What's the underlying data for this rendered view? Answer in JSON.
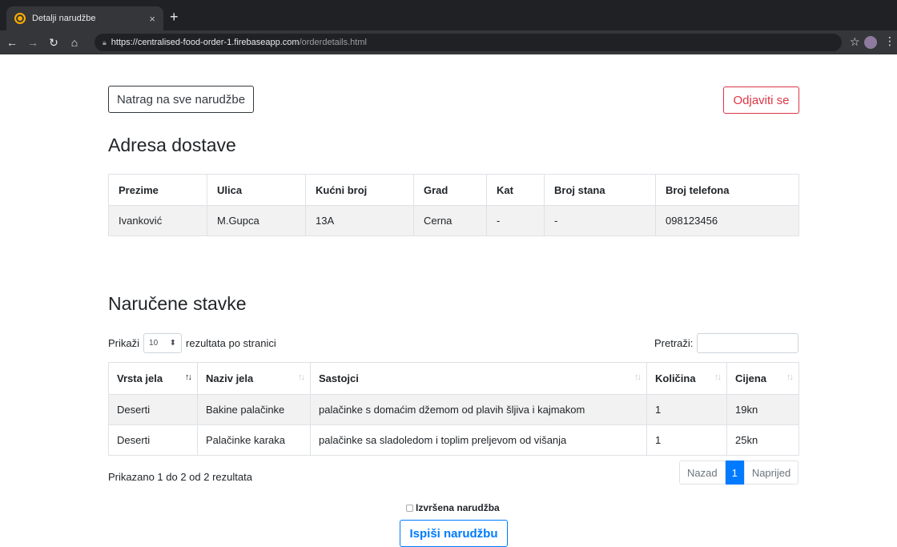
{
  "browser": {
    "tab_title": "Detalji narudžbe",
    "tab_close": "×",
    "new_tab": "+",
    "url_host": "https://centralised-food-order-1.firebaseapp.com",
    "url_path": "/orderdetails.html",
    "icons": [
      "back-icon",
      "forward-icon",
      "reload-icon",
      "home-icon",
      "lock-icon",
      "star-icon",
      "menu-icon"
    ]
  },
  "header": {
    "back_button": "Natrag na sve narudžbe",
    "logout_button": "Odjaviti se"
  },
  "address": {
    "title": "Adresa dostave",
    "columns": [
      "Prezime",
      "Ulica",
      "Kućni broj",
      "Grad",
      "Kat",
      "Broj stana",
      "Broj telefona"
    ],
    "row": [
      "Ivanković",
      "M.Gupca",
      "13A",
      "Cerna",
      "-",
      "-",
      "098123456"
    ]
  },
  "items": {
    "title": "Naručene stavke",
    "length_prefix": "Prikaži",
    "length_value": "10",
    "length_suffix": "rezultata po stranici",
    "search_label": "Pretraži:",
    "columns": [
      "Vrsta jela",
      "Naziv jela",
      "Sastojci",
      "Količina",
      "Cijena"
    ],
    "rows": [
      [
        "Deserti",
        "Bakine palačinke",
        "palačinke s domaćim džemom od plavih šljiva i kajmakom",
        "1",
        "19kn"
      ],
      [
        "Deserti",
        "Palačinke karaka",
        "palačinke sa sladoledom i toplim preljevom od višanja",
        "1",
        "25kn"
      ]
    ],
    "info": "Prikazano 1 do 2 od 2 rezultata",
    "pager": {
      "prev": "Nazad",
      "current": "1",
      "next": "Naprijed"
    }
  },
  "footer": {
    "done_label": "Izvršena narudžba",
    "print_button": "Ispiši narudžbu"
  },
  "colors": {
    "primary": "#007bff",
    "danger": "#dc3545",
    "dark": "#343a40"
  }
}
